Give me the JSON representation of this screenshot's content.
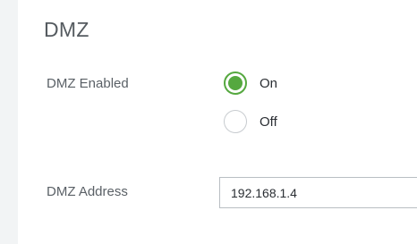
{
  "section": {
    "title": "DMZ"
  },
  "dmz_enabled": {
    "label": "DMZ Enabled",
    "options": [
      {
        "label": "On",
        "selected": true
      },
      {
        "label": "Off",
        "selected": false
      }
    ]
  },
  "dmz_address": {
    "label": "DMZ Address",
    "value": "192.168.1.4"
  },
  "colors": {
    "accent_green": "#55a83f",
    "label_gray": "#5a6066",
    "rail_gray": "#f2f4f5"
  },
  "icons": {
    "radio_selected": "radio-selected-icon",
    "radio_unselected": "radio-unselected-icon"
  }
}
